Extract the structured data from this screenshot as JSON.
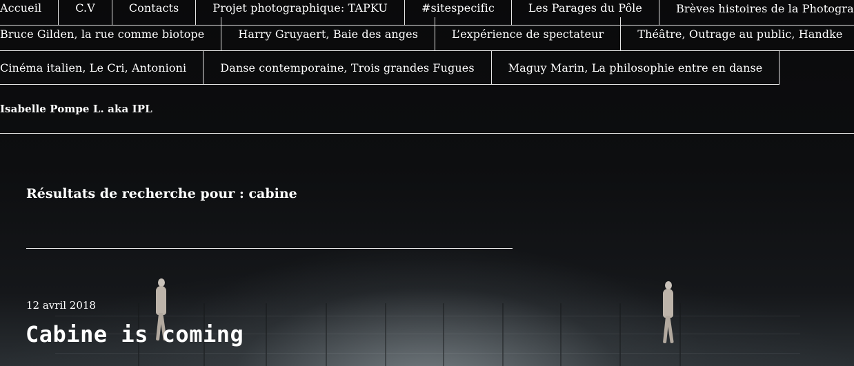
{
  "nav": {
    "row1": [
      "Accueil",
      "C.V",
      "Contacts",
      "Projet photographique: TAPKU",
      "#sitespecific",
      "Les Parages du Pôle",
      "Brèves histoires de la Photographie"
    ],
    "row2": [
      "Bruce Gilden, la rue comme biotope",
      "Harry Gruyaert, Baie des anges",
      "L’expérience de spectateur",
      "Théâtre, Outrage au public, Handke"
    ],
    "row3": [
      "Cinéma italien, Le Cri, Antonioni",
      "Danse contemporaine, Trois grandes Fugues",
      "Maguy Marin, La philosophie entre en danse"
    ],
    "row4": "Isabelle Pompe L. aka IPL",
    "dropdown_icon": "chevron-down-icon"
  },
  "search": {
    "heading": "Résultats de recherche pour : cabine"
  },
  "post": {
    "date": "12 avril 2018",
    "title": "Cabine is coming"
  }
}
